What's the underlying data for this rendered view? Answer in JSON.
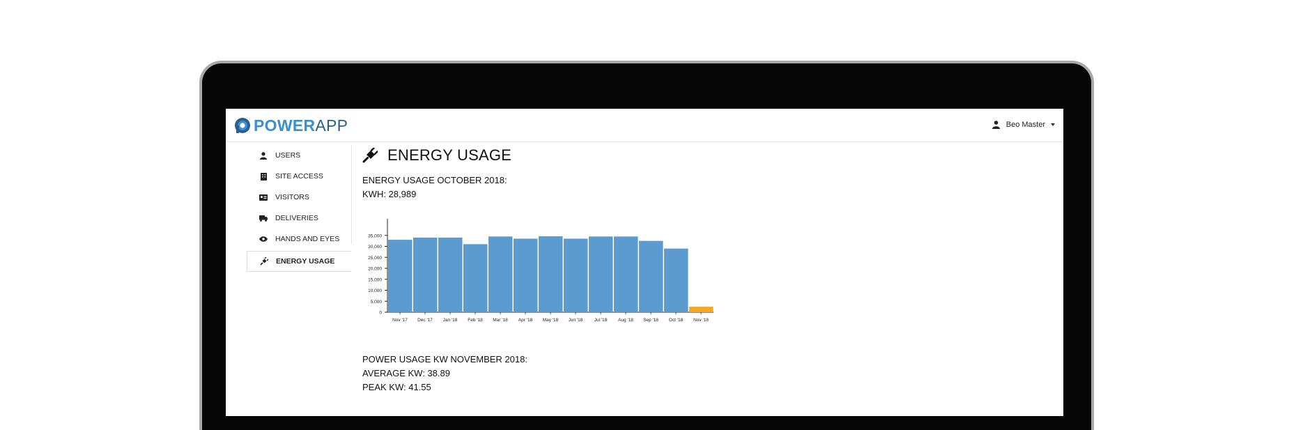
{
  "app": {
    "logo_primary": "POWER",
    "logo_secondary": "APP"
  },
  "user_menu": {
    "name": "Beo Master"
  },
  "sidebar": {
    "items": [
      {
        "label": "USERS",
        "icon": "user-icon"
      },
      {
        "label": "SITE ACCESS",
        "icon": "building-icon"
      },
      {
        "label": "VISITORS",
        "icon": "id-card-icon"
      },
      {
        "label": "DELIVERIES",
        "icon": "truck-icon"
      },
      {
        "label": "HANDS AND EYES",
        "icon": "eye-icon"
      },
      {
        "label": "ENERGY USAGE",
        "icon": "plug-icon",
        "active": true
      }
    ]
  },
  "main": {
    "title": "ENERGY USAGE",
    "summary_heading": "ENERGY USAGE OCTOBER 2018:",
    "summary_kwh": "KWH: 28,989",
    "power_heading": "POWER USAGE KW NOVEMBER 2018:",
    "average_kw": "AVERAGE KW: 38.89",
    "peak_kw": "PEAK KW: 41.55"
  },
  "colors": {
    "bar": "#5b9bd0",
    "bar_current": "#f5a623",
    "accent": "#3a8fd1"
  },
  "chart_data": {
    "type": "bar",
    "categories": [
      "Nov '17",
      "Dec '17",
      "Jan '18",
      "Feb '18",
      "Mar '18",
      "Apr '18",
      "May '18",
      "Jun '18",
      "Jul '18",
      "Aug '18",
      "Sep '18",
      "Oct '18",
      "Nov '18"
    ],
    "values": [
      33000,
      34000,
      34000,
      31000,
      34500,
      33500,
      34600,
      33500,
      34500,
      34500,
      32500,
      29000,
      2500
    ],
    "yticks": [
      "0",
      "5,000",
      "10,000",
      "15,000",
      "20,000",
      "25,000",
      "30,000",
      "35,000"
    ],
    "ylim": [
      0,
      40000
    ],
    "highlight_index": 12,
    "grid": false
  }
}
